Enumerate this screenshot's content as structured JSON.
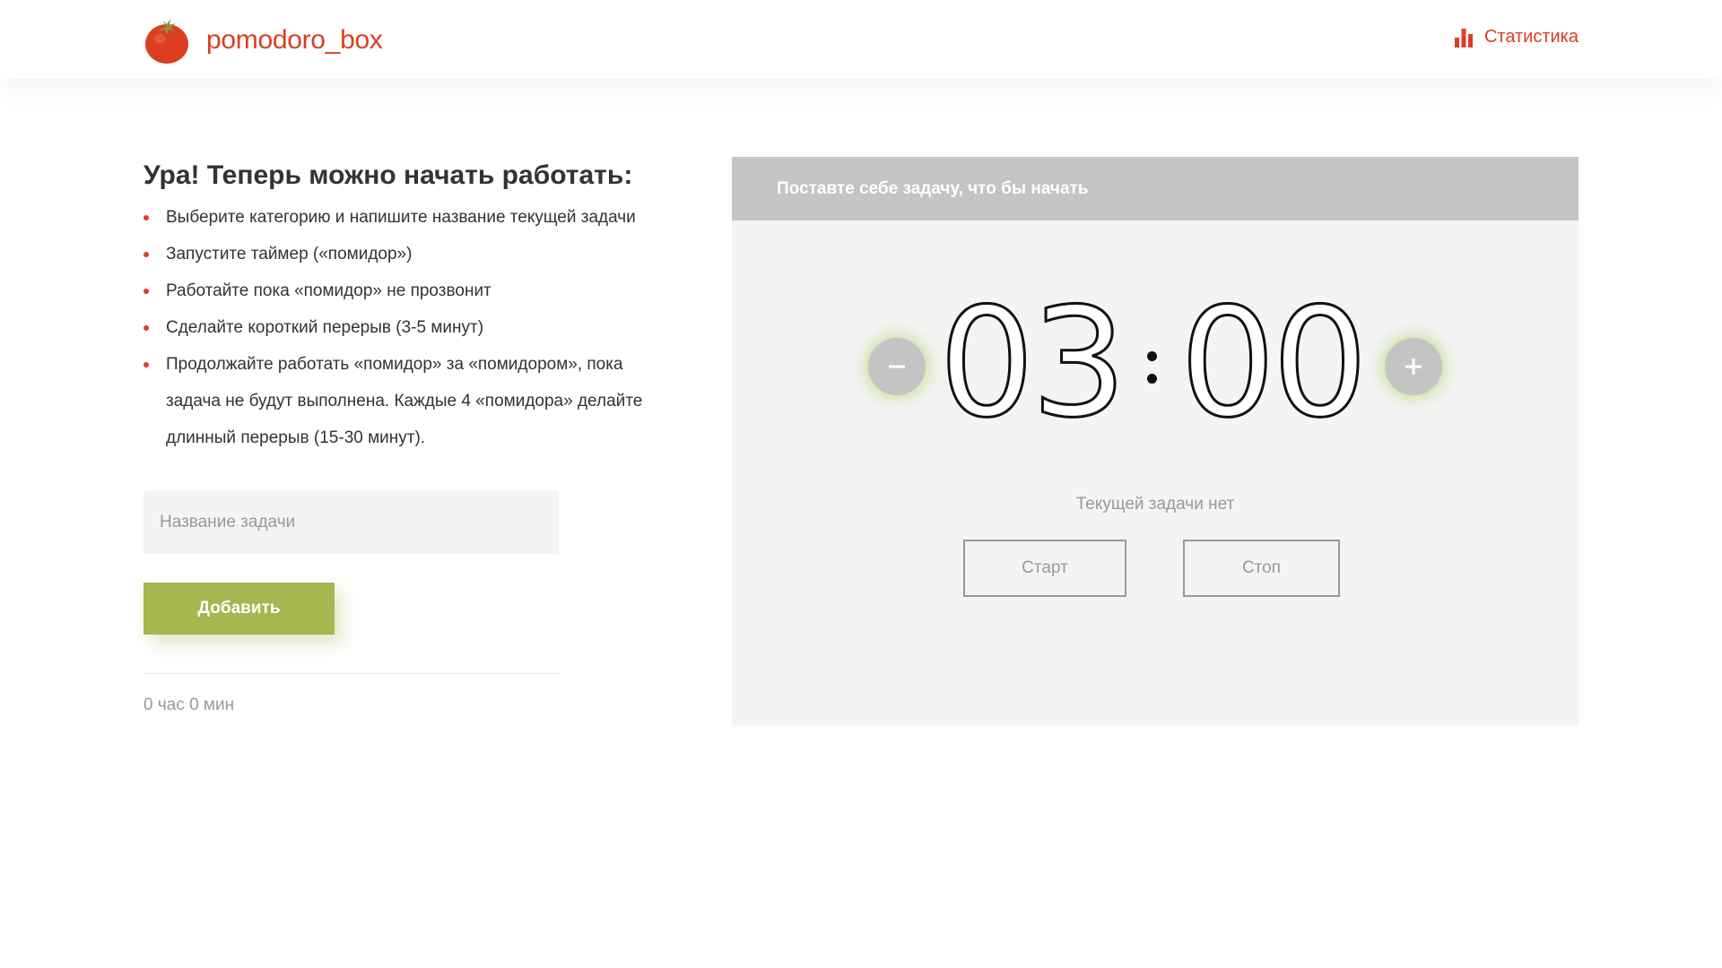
{
  "header": {
    "logo_text": "pomodoro_box",
    "stats_label": "Статистика"
  },
  "intro": {
    "title": "Ура! Теперь можно начать работать:",
    "steps": [
      "Выберите категорию и напишите название текущей задачи",
      "Запустите таймер («помидор»)",
      "Работайте пока «помидор» не прозвонит",
      "Сделайте короткий перерыв (3-5 минут)",
      "Продолжайте работать «помидор» за «помидором», пока задача не будут выполнена. Каждые 4 «помидора» делайте длинный перерыв (15-30 минут)."
    ]
  },
  "task_form": {
    "input_placeholder": "Название задачи",
    "input_value": "",
    "add_label": "Добавить",
    "total_time": "0 час 0 мин"
  },
  "timer": {
    "header_text": "Поставте себе задачу, что бы начать",
    "minutes": "03",
    "seconds": "00",
    "no_task_text": "Текущей задачи нет",
    "start_label": "Старт",
    "stop_label": "Стоп"
  },
  "icons": {
    "logo": "tomato-icon",
    "stats": "bar-chart-icon",
    "decrease": "minus-icon",
    "increase": "plus-icon"
  },
  "colors": {
    "brand": "#dc3e22",
    "accent_green": "#a8b64f",
    "panel_header": "#c4c4c4",
    "panel_bg": "#f4f4f4",
    "muted_text": "#999999"
  }
}
